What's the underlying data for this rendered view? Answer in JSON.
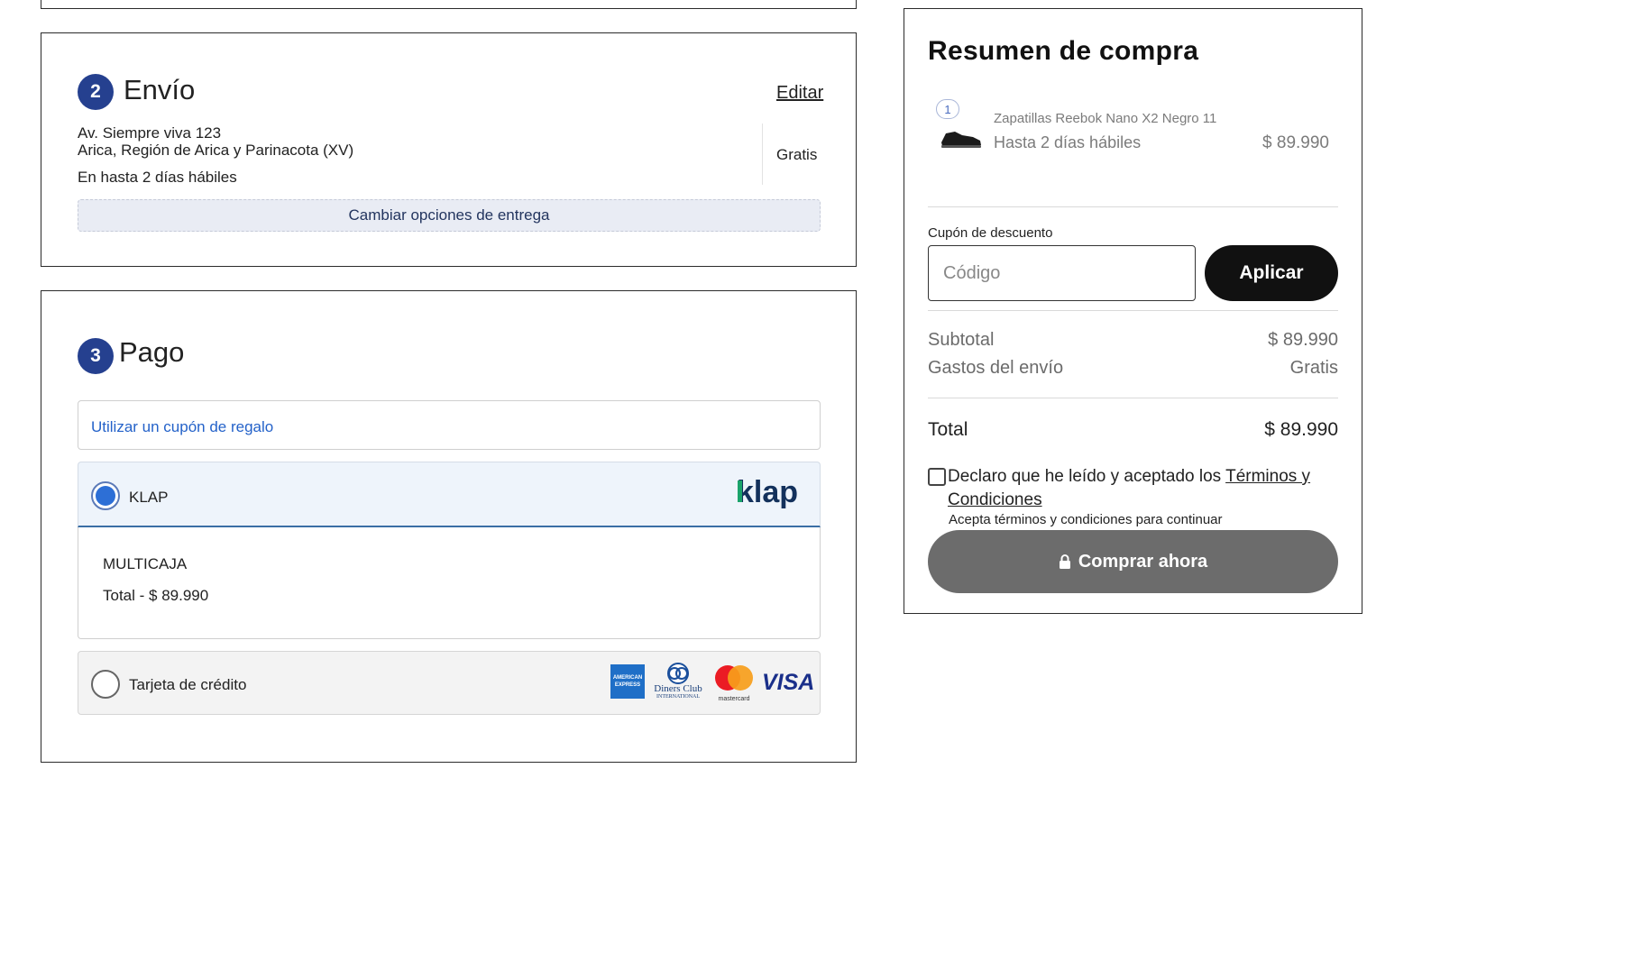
{
  "shipping": {
    "step_number": "2",
    "title": "Envío",
    "edit_label": "Editar",
    "address_line1": "Av. Siempre viva 123",
    "address_line2": "Arica, Región de Arica y Parinacota (XV)",
    "delivery_time": "En hasta 2 días hábiles",
    "cost": "Gratis",
    "change_button": "Cambiar opciones de entrega"
  },
  "payment": {
    "step_number": "3",
    "title": "Pago",
    "gift_coupon_link": "Utilizar un cupón de regalo",
    "options": [
      {
        "label": "KLAP",
        "selected": true,
        "logo_text": "klap",
        "method": "MULTICAJA",
        "total": "Total - $ 89.990"
      },
      {
        "label": "Tarjeta de crédito",
        "selected": false
      }
    ],
    "card_brands": {
      "amex_line1": "AMERICAN",
      "amex_line2": "EXPRESS",
      "diners_line1": "Diners Club",
      "diners_line2": "INTERNATIONAL",
      "mastercard": "mastercard",
      "visa": "VISA"
    }
  },
  "summary": {
    "title": "Resumen de compra",
    "item": {
      "quantity": "1",
      "name": "Zapatillas Reebok Nano X2 Negro 11",
      "delivery": "Hasta 2 días hábiles",
      "price": "$ 89.990"
    },
    "coupon": {
      "label": "Cupón de descuento",
      "placeholder": "Código",
      "apply_label": "Aplicar"
    },
    "subtotal_label": "Subtotal",
    "subtotal_value": "$ 89.990",
    "shipping_label": "Gastos del envío",
    "shipping_value": "Gratis",
    "total_label": "Total",
    "total_value": "$ 89.990",
    "terms_prefix": "Declaro que he leído y aceptado los",
    "terms_link_line1": "Términos y",
    "terms_link_line2": "Condiciones",
    "terms_hint": "Acepta términos y condiciones para continuar",
    "buy_label": "Comprar ahora"
  },
  "colors": {
    "step_badge": "#25408f",
    "link_blue": "#2462c9",
    "klap_green": "#1aa36b",
    "klap_navy": "#13315c",
    "buy_button": "#6c6c6c"
  }
}
